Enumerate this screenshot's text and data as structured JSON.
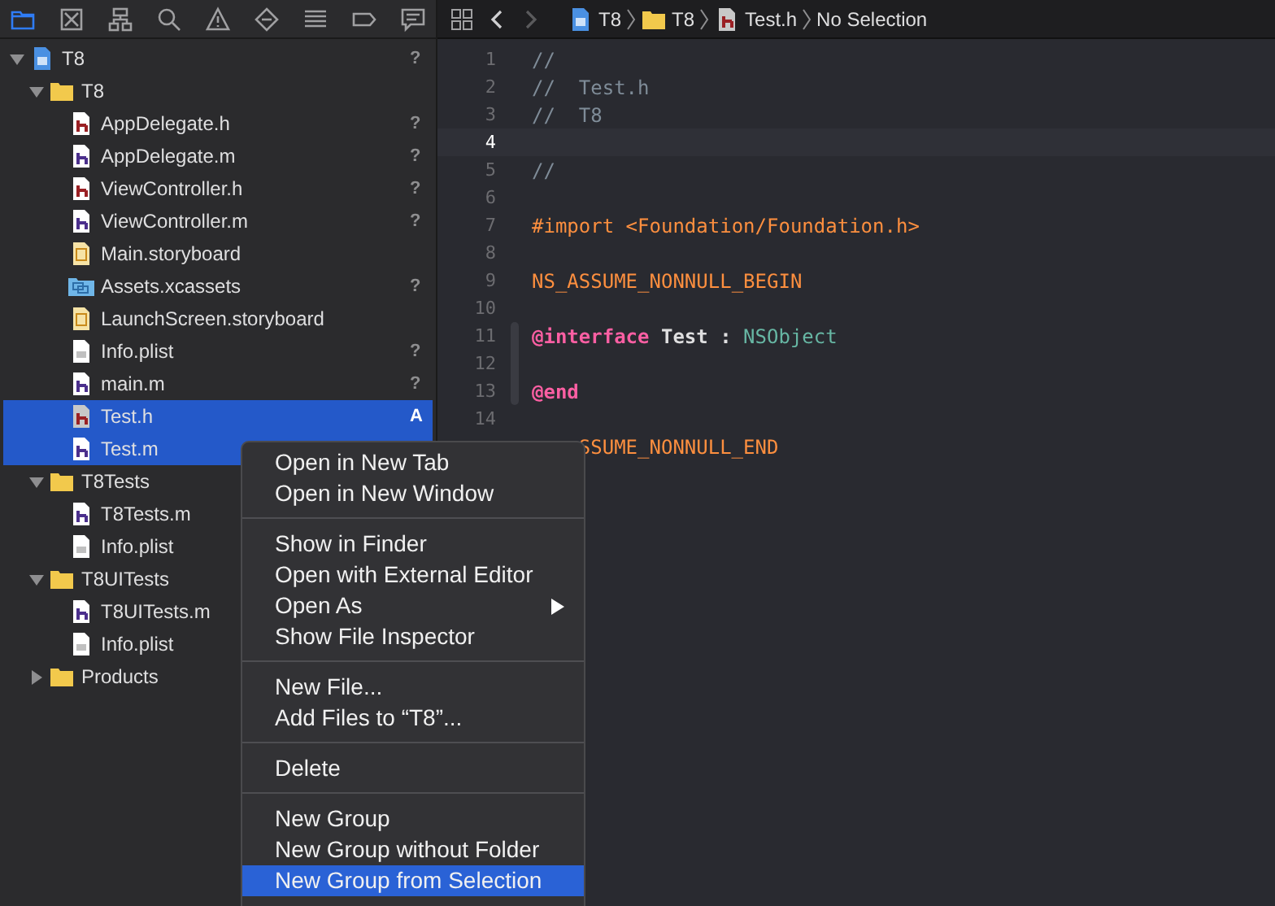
{
  "navigator_tabs": [
    {
      "selected": true
    },
    {
      "selected": false
    },
    {
      "selected": false
    },
    {
      "selected": false
    },
    {
      "selected": false
    },
    {
      "selected": false
    },
    {
      "selected": false
    },
    {
      "selected": false
    },
    {
      "selected": false
    }
  ],
  "tree": [
    {
      "name": "T8",
      "kind": "project",
      "status": "?",
      "expanded": true,
      "selected": false,
      "children": [
        {
          "name": "T8",
          "kind": "folder",
          "expanded": true,
          "selected": false,
          "children": [
            {
              "name": "AppDelegate.h",
              "kind": "h",
              "status": "?",
              "selected": false
            },
            {
              "name": "AppDelegate.m",
              "kind": "m",
              "status": "?",
              "selected": false
            },
            {
              "name": "ViewController.h",
              "kind": "h",
              "status": "?",
              "selected": false
            },
            {
              "name": "ViewController.m",
              "kind": "m",
              "status": "?",
              "selected": false
            },
            {
              "name": "Main.storyboard",
              "kind": "storyboard",
              "selected": false
            },
            {
              "name": "Assets.xcassets",
              "kind": "xcassets",
              "status": "?",
              "selected": false
            },
            {
              "name": "LaunchScreen.storyboard",
              "kind": "storyboard",
              "selected": false
            },
            {
              "name": "Info.plist",
              "kind": "plist",
              "status": "?",
              "selected": false
            },
            {
              "name": "main.m",
              "kind": "m",
              "status": "?",
              "selected": false
            },
            {
              "name": "Test.h",
              "kind": "h",
              "status": "A",
              "selected": true
            },
            {
              "name": "Test.m",
              "kind": "m",
              "selected": true
            }
          ]
        },
        {
          "name": "T8Tests",
          "kind": "folder",
          "expanded": true,
          "selected": false,
          "children": [
            {
              "name": "T8Tests.m",
              "kind": "m",
              "selected": false
            },
            {
              "name": "Info.plist",
              "kind": "plist",
              "selected": false
            }
          ]
        },
        {
          "name": "T8UITests",
          "kind": "folder",
          "expanded": true,
          "selected": false,
          "children": [
            {
              "name": "T8UITests.m",
              "kind": "m",
              "selected": false
            },
            {
              "name": "Info.plist",
              "kind": "plist",
              "selected": false
            }
          ]
        },
        {
          "name": "Products",
          "kind": "folder",
          "expanded": false,
          "selected": false
        }
      ]
    }
  ],
  "breadcrumb": [
    {
      "label": "T8",
      "kind": "project"
    },
    {
      "label": "T8",
      "kind": "folder"
    },
    {
      "label": "Test.h",
      "kind": "h"
    },
    {
      "label": "No Selection",
      "kind": "symbol"
    }
  ],
  "code_lines": [
    {
      "number": "1",
      "current": false,
      "tokens": [
        {
          "text": "//",
          "kind": "comment"
        }
      ]
    },
    {
      "number": "2",
      "current": false,
      "tokens": [
        {
          "text": "//  Test.h",
          "kind": "comment"
        }
      ]
    },
    {
      "number": "3",
      "current": false,
      "tokens": [
        {
          "text": "//  T8",
          "kind": "comment"
        }
      ]
    },
    {
      "number": "4",
      "current": true
    },
    {
      "number": "5",
      "current": false,
      "tokens": [
        {
          "text": "//",
          "kind": "comment"
        }
      ]
    },
    {
      "number": "6",
      "current": false
    },
    {
      "number": "7",
      "current": false,
      "tokens": [
        {
          "text": "#import <Foundation/Foundation.h>",
          "kind": "preprocessor"
        }
      ]
    },
    {
      "number": "8",
      "current": false
    },
    {
      "number": "9",
      "current": false,
      "tokens": [
        {
          "text": "NS_ASSUME_NONNULL_BEGIN",
          "kind": "macro"
        }
      ]
    },
    {
      "number": "10",
      "current": false
    },
    {
      "number": "11",
      "current": false,
      "tokens": [
        {
          "text": "@interface",
          "kind": "keyword"
        },
        {
          "text": " Test : ",
          "kind": "plain"
        },
        {
          "text": "NSObject",
          "kind": "type"
        }
      ]
    },
    {
      "number": "12",
      "current": false
    },
    {
      "number": "13",
      "current": false,
      "tokens": [
        {
          "text": "@end",
          "kind": "keyword"
        }
      ]
    },
    {
      "number": "14",
      "current": false
    },
    {
      "partly_covered": true,
      "tokens": [
        {
          "text": "SSUME_NONNULL_END",
          "kind": "macro"
        }
      ]
    }
  ],
  "context_menu": {
    "sections": [
      [
        {
          "label": "Open in New Tab",
          "selected": false,
          "submenu": false
        },
        {
          "label": "Open in New Window",
          "selected": false,
          "submenu": false
        }
      ],
      [
        {
          "label": "Show in Finder",
          "selected": false,
          "submenu": false
        },
        {
          "label": "Open with External Editor",
          "selected": false,
          "submenu": false
        },
        {
          "label": "Open As",
          "selected": false,
          "submenu": true
        },
        {
          "label": "Show File Inspector",
          "selected": false,
          "submenu": false
        }
      ],
      [
        {
          "label": "New File...",
          "selected": false,
          "submenu": false
        },
        {
          "label": "Add Files to “T8”...",
          "selected": false,
          "submenu": false
        }
      ],
      [
        {
          "label": "Delete",
          "selected": false,
          "submenu": false
        }
      ],
      [
        {
          "label": "New Group",
          "selected": false,
          "submenu": false
        },
        {
          "label": "New Group without Folder",
          "selected": false,
          "submenu": false
        },
        {
          "label": "New Group from Selection",
          "selected": true,
          "submenu": false
        }
      ]
    ]
  }
}
